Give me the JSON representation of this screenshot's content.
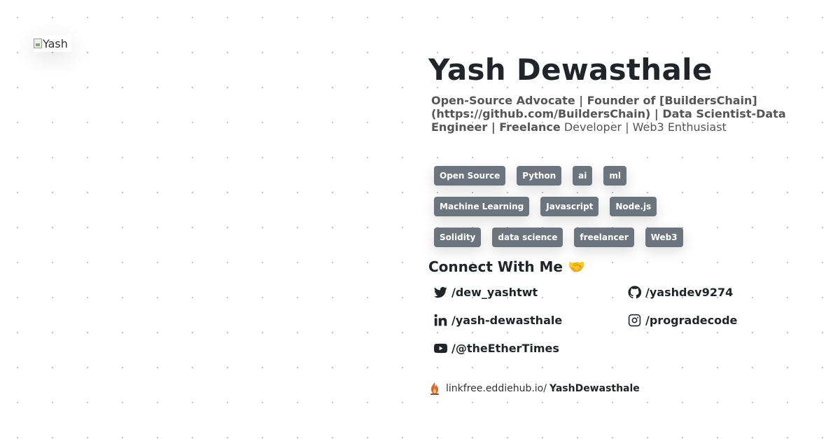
{
  "avatar": {
    "alt": "Yash"
  },
  "profile": {
    "name": "Yash Dewasthale",
    "bio_bold": "Open-Source Advocate | Founder of [BuildersChain] (https://github.com/BuildersChain) | Data Scientist-Data Engineer | Freelance",
    "bio_rest": " Developer | Web3 Enthusiast"
  },
  "tags": {
    "row1": [
      "Open Source",
      "Python",
      "ai",
      "ml"
    ],
    "row2": [
      "Machine Learning",
      "Javascript",
      "Node.js"
    ],
    "row3": [
      "Solidity",
      "data science",
      "freelancer",
      "Web3"
    ]
  },
  "connect": {
    "title": "Connect With Me 🤝",
    "twitter": {
      "icon": "twitter-icon",
      "label": "/dew_yashtwt"
    },
    "github": {
      "icon": "github-icon",
      "label": "/yashdev9274"
    },
    "linkedin": {
      "icon": "linkedin-icon",
      "label": "/yash-dewasthale"
    },
    "instagram": {
      "icon": "instagram-icon",
      "label": "/progradecode"
    },
    "youtube": {
      "icon": "youtube-icon",
      "label": "/@theEtherTimes"
    }
  },
  "footer": {
    "icon": "linkfree-flame-icon",
    "prefix": "linkfree.eddiehub.io/",
    "username": "YashDewasthale"
  },
  "colors": {
    "tag_bg": "#6c757d",
    "text": "#212529",
    "muted": "#555555"
  }
}
